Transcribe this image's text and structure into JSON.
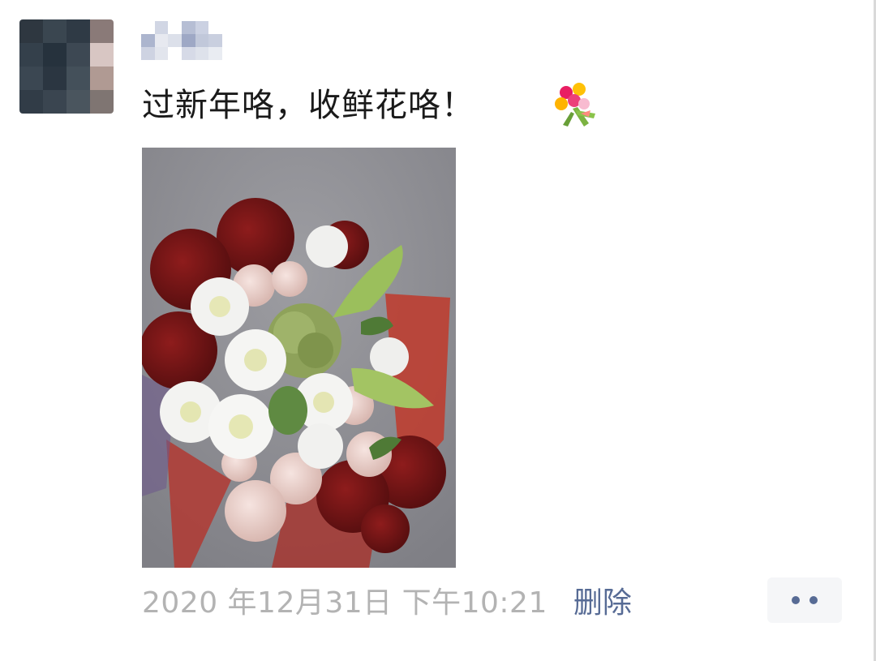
{
  "post": {
    "username": "",
    "text": "过新年咯，收鲜花咯！",
    "emoji": "bouquet-emoji",
    "image": "bouquet-photo",
    "timestamp": "2020 年12月31日 下午10:21",
    "delete_label": "删除",
    "more_icon": "more-dots-icon"
  },
  "colors": {
    "link": "#576b95",
    "timestamp": "#b3b3b3",
    "text": "#1a1a1a",
    "more_button_bg": "#f5f6f8"
  }
}
